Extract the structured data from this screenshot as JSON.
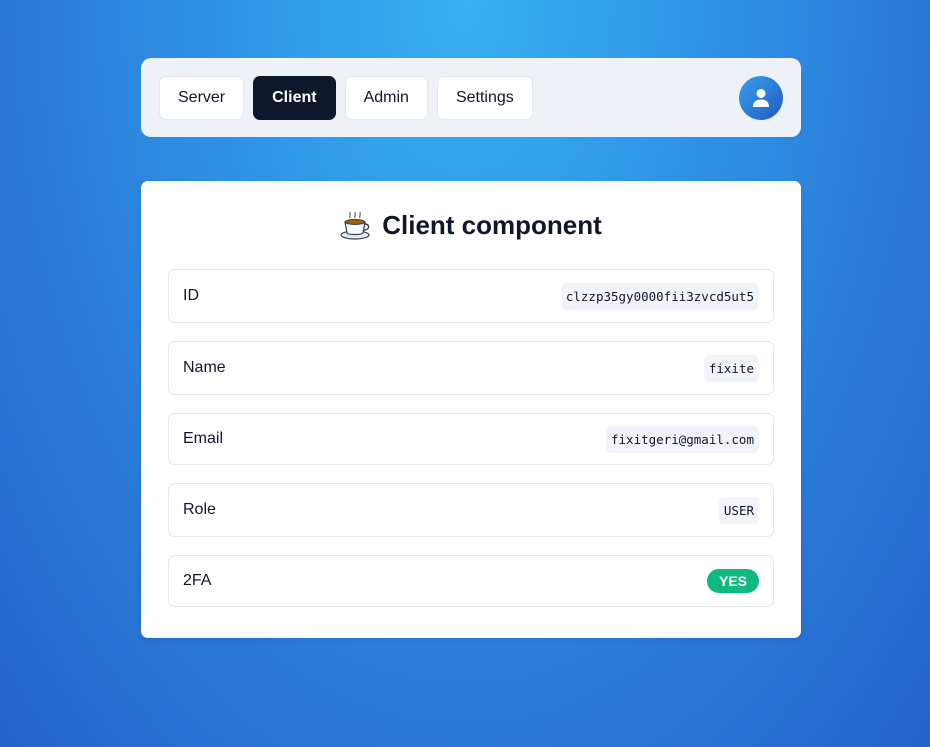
{
  "nav": {
    "tabs": [
      {
        "label": "Server",
        "active": false
      },
      {
        "label": "Client",
        "active": true
      },
      {
        "label": "Admin",
        "active": false
      },
      {
        "label": "Settings",
        "active": false
      }
    ],
    "avatar_icon": "user-icon"
  },
  "card": {
    "title_icon": "coffee-icon",
    "title": "Client component",
    "rows": [
      {
        "label": "ID",
        "value": "clzzp35gy0000fii3zvcd5ut5"
      },
      {
        "label": "Name",
        "value": "fixite"
      },
      {
        "label": "Email",
        "value": "fixitgeri@gmail.com"
      },
      {
        "label": "Role",
        "value": "USER"
      },
      {
        "label": "2FA",
        "value": "YES"
      }
    ]
  },
  "colors": {
    "accent_dark": "#0f172a",
    "success": "#10b981",
    "background_top": "#38b0f2",
    "background_bottom": "#2563c9"
  }
}
